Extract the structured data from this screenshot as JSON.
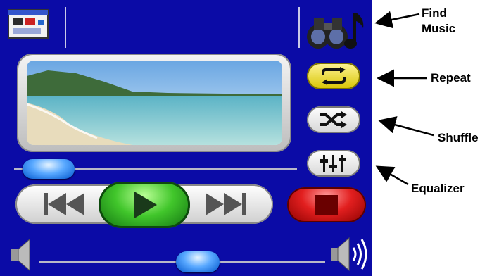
{
  "callouts": {
    "find_music_line1": "Find",
    "find_music_line2": "Music",
    "repeat": "Repeat",
    "shuffle": "Shuffle",
    "equalizer": "Equalizer"
  },
  "player": {
    "background": "#0b0ba6",
    "progress_fraction": 0.08,
    "volume_fraction": 0.5,
    "repeat_active": true
  },
  "icons": {
    "home": "album-window-icon",
    "find_music": "binoculars-music-note-icon",
    "repeat": "repeat-icon",
    "shuffle": "shuffle-icon",
    "equalizer": "equalizer-icon",
    "previous": "previous-track-icon",
    "play": "play-icon",
    "next": "next-track-icon",
    "stop": "stop-icon",
    "volume_low": "speaker-low-icon",
    "volume_high": "speaker-high-icon"
  }
}
